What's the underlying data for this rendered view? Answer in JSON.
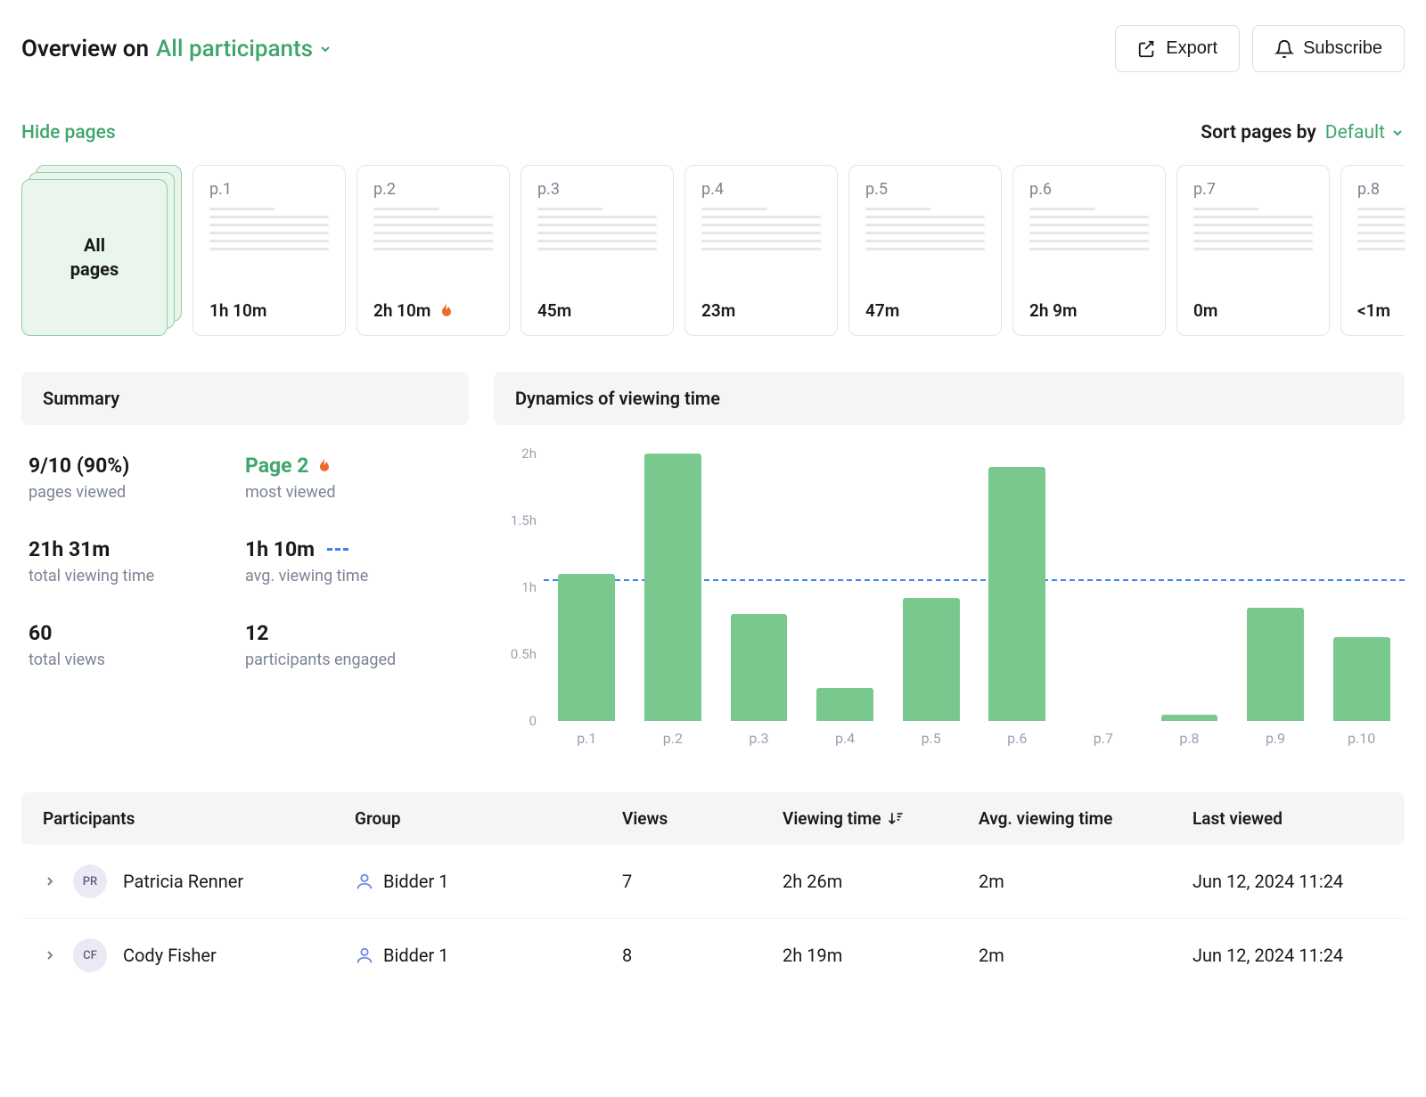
{
  "header": {
    "title_prefix": "Overview on",
    "participants_dropdown": "All participants",
    "export_label": "Export",
    "subscribe_label": "Subscribe"
  },
  "controls": {
    "hide_pages": "Hide pages",
    "sort_label": "Sort pages by",
    "sort_value": "Default"
  },
  "page_cards": {
    "all_label": "All\npages",
    "items": [
      {
        "label": "p.1",
        "time": "1h 10m",
        "hot": false
      },
      {
        "label": "p.2",
        "time": "2h 10m",
        "hot": true
      },
      {
        "label": "p.3",
        "time": "45m",
        "hot": false
      },
      {
        "label": "p.4",
        "time": "23m",
        "hot": false
      },
      {
        "label": "p.5",
        "time": "47m",
        "hot": false
      },
      {
        "label": "p.6",
        "time": "2h 9m",
        "hot": false
      },
      {
        "label": "p.7",
        "time": "0m",
        "hot": false
      },
      {
        "label": "p.8",
        "time": "<1m",
        "hot": false
      }
    ]
  },
  "summary": {
    "title": "Summary",
    "stats": {
      "pages_viewed": {
        "value": "9/10 (90%)",
        "label": "pages viewed"
      },
      "most_viewed": {
        "value": "Page 2",
        "label": "most viewed",
        "hot": true
      },
      "total_time": {
        "value": "21h 31m",
        "label": "total viewing time"
      },
      "avg_time": {
        "value": "1h 10m",
        "label": "avg. viewing time"
      },
      "total_views": {
        "value": "60",
        "label": "total views"
      },
      "participants": {
        "value": "12",
        "label": "participants engaged"
      }
    }
  },
  "dynamics": {
    "title": "Dynamics of viewing time"
  },
  "chart_data": {
    "type": "bar",
    "categories": [
      "p.1",
      "p.2",
      "p.3",
      "p.4",
      "p.5",
      "p.6",
      "p.7",
      "p.8",
      "p.9",
      "p.10"
    ],
    "values": [
      1.1,
      2.0,
      0.8,
      0.25,
      0.92,
      1.9,
      0,
      0.05,
      0.85,
      0.63
    ],
    "y_ticks": [
      "2h",
      "1.5h",
      "1h",
      "0.5h",
      "0"
    ],
    "ylim": [
      0,
      2
    ],
    "avg_line_value": 1.05,
    "xlabel": "",
    "ylabel": "",
    "title": "Dynamics of viewing time"
  },
  "table": {
    "columns": {
      "participants": "Participants",
      "group": "Group",
      "views": "Views",
      "viewing_time": "Viewing time",
      "avg_viewing_time": "Avg. viewing time",
      "last_viewed": "Last viewed"
    },
    "rows": [
      {
        "initials": "PR",
        "name": "Patricia Renner",
        "group": "Bidder 1",
        "views": "7",
        "viewing_time": "2h 26m",
        "avg": "2m",
        "last": "Jun 12, 2024 11:24"
      },
      {
        "initials": "CF",
        "name": "Cody Fisher",
        "group": "Bidder 1",
        "views": "8",
        "viewing_time": "2h 19m",
        "avg": "2m",
        "last": "Jun 12, 2024 11:24"
      }
    ]
  }
}
